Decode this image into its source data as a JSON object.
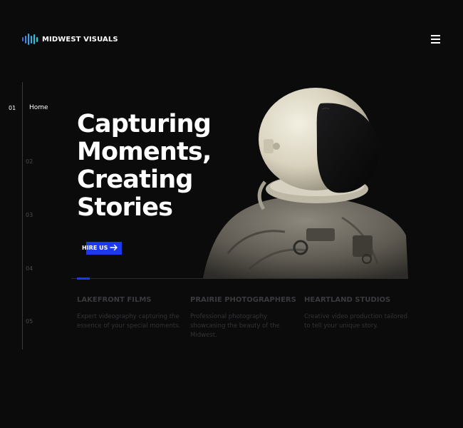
{
  "brand": {
    "name": "MIDWEST VISUALS",
    "accent": "#1d39f0"
  },
  "menu": {
    "icon": "hamburger-menu-icon"
  },
  "rail": {
    "items": [
      {
        "num": "01",
        "label": "Home",
        "active": true
      },
      {
        "num": "02"
      },
      {
        "num": "03"
      },
      {
        "num": "04"
      },
      {
        "num": "05"
      }
    ]
  },
  "hero": {
    "headline": [
      "Capturing",
      "Moments,",
      "Creating",
      "Stories"
    ],
    "cta_label": "HIRE US",
    "cta_icon": "arrow-right-icon",
    "image": "astronaut-photo"
  },
  "features": [
    {
      "title": "LAKEFRONT FILMS",
      "text": "Expert videography capturing the essence of your special moments."
    },
    {
      "title": "PRAIRIE PHOTOGRAPHERS",
      "text": "Professional photography showcasing the beauty of the Midwest."
    },
    {
      "title": "HEARTLAND STUDIOS",
      "text": "Creative video production tailored to tell your unique story."
    }
  ]
}
